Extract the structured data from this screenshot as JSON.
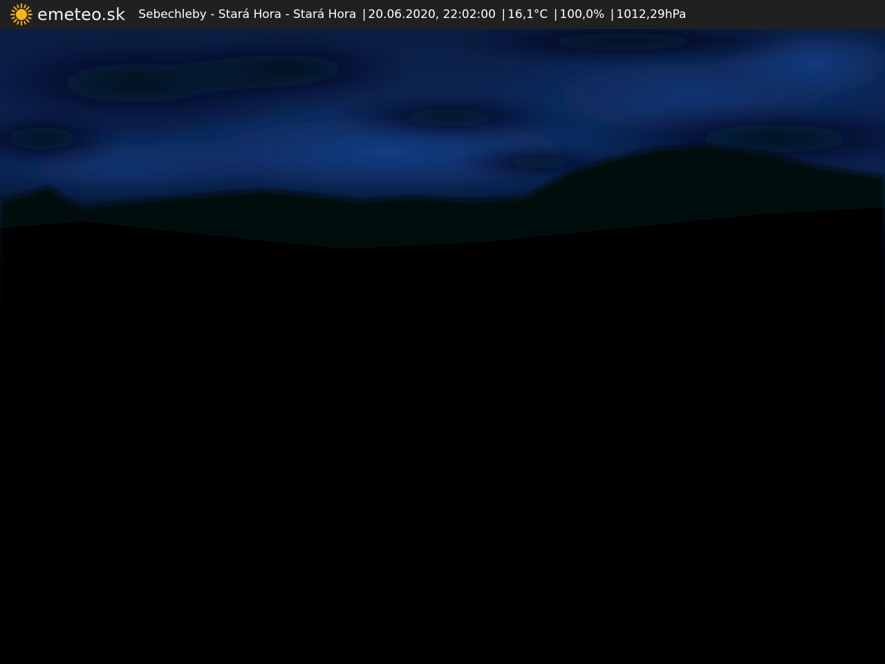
{
  "header": {
    "brand": "emeteo.sk",
    "location": "Sebechleby - Stará Hora - Stará Hora",
    "separator": "|",
    "datetime": "20.06.2020, 22:02:00",
    "temperature": "16,1°C",
    "humidity": "100,0%",
    "pressure": "1012,29hPa",
    "logo_icon": "sun-icon",
    "logo_color": "#f2a81d",
    "bar_color": "#202020"
  },
  "scene": {
    "description_type": "webcam-night-sky",
    "sky_color": "#0b2452",
    "ground_color": "#030304"
  }
}
